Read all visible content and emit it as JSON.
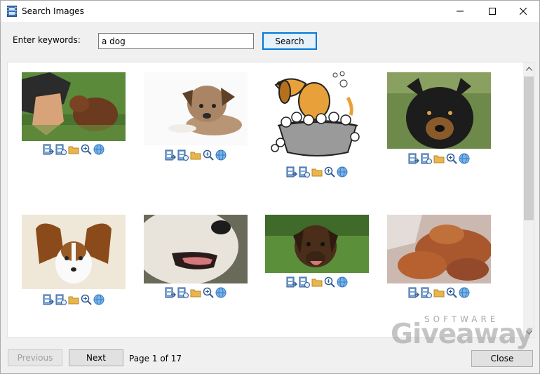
{
  "window": {
    "title": "Search Images",
    "icon": "filmstrip-icon",
    "controls": [
      "minimize-icon",
      "maximize-icon",
      "close-icon"
    ]
  },
  "search": {
    "label": "Enter keywords:",
    "value": "a dog",
    "button_label": "Search"
  },
  "results": {
    "action_icons": [
      "save-to-file-icon",
      "save-copy-icon",
      "open-folder-icon",
      "zoom-icon",
      "web-icon"
    ],
    "images": [
      {
        "subject": "person-petting-dog"
      },
      {
        "subject": "dog-lying-down"
      },
      {
        "subject": "cartoon-dog-bath"
      },
      {
        "subject": "black-tan-dog"
      },
      {
        "subject": "papillon-dog"
      },
      {
        "subject": "white-dog-closeup"
      },
      {
        "subject": "brown-dog-grass"
      },
      {
        "subject": "puppies-sleeping"
      }
    ]
  },
  "pager": {
    "previous_label": "Previous",
    "next_label": "Next",
    "page_label": "Page 1 of 17",
    "current_page": 1,
    "total_pages": 17
  },
  "footer": {
    "close_label": "Close"
  },
  "watermark": {
    "top": "SOFTWARE",
    "main": "Giveaway"
  },
  "colors": {
    "accent": "#0078d7",
    "window_bg": "#f0f0f0",
    "folder": "#e8b64c",
    "globe": "#2e7bc4"
  }
}
